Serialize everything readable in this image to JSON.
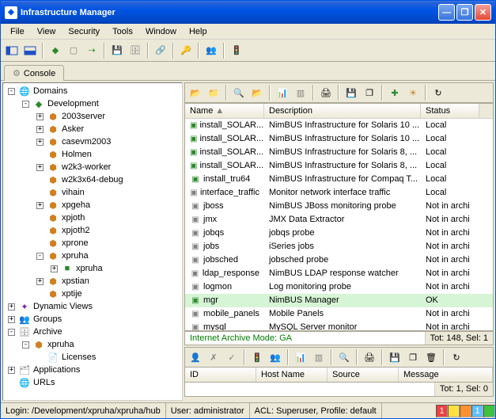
{
  "window": {
    "title": "Infrastructure Manager"
  },
  "menu": [
    "File",
    "View",
    "Security",
    "Tools",
    "Window",
    "Help"
  ],
  "tab": {
    "label": "Console"
  },
  "tree": [
    {
      "ind": 0,
      "exp": "-",
      "icon": "🌐",
      "cls": "ic-blue",
      "label": "Domains"
    },
    {
      "ind": 1,
      "exp": "-",
      "icon": "◆",
      "cls": "ic-green",
      "label": "Development"
    },
    {
      "ind": 2,
      "exp": "+",
      "icon": "⬢",
      "cls": "ic-orange",
      "label": "2003server"
    },
    {
      "ind": 2,
      "exp": "+",
      "icon": "⬢",
      "cls": "ic-orange",
      "label": "Asker"
    },
    {
      "ind": 2,
      "exp": "+",
      "icon": "⬢",
      "cls": "ic-orange",
      "label": "casevm2003"
    },
    {
      "ind": 2,
      "exp": "",
      "icon": "⬢",
      "cls": "ic-orange",
      "label": "Holmen"
    },
    {
      "ind": 2,
      "exp": "+",
      "icon": "⬢",
      "cls": "ic-orange",
      "label": "w2k3-worker"
    },
    {
      "ind": 2,
      "exp": "",
      "icon": "⬢",
      "cls": "ic-orange",
      "label": "w2k3x64-debug"
    },
    {
      "ind": 2,
      "exp": "",
      "icon": "⬢",
      "cls": "ic-orange",
      "label": "vihain"
    },
    {
      "ind": 2,
      "exp": "+",
      "icon": "⬢",
      "cls": "ic-orange",
      "label": "xpgeha"
    },
    {
      "ind": 2,
      "exp": "",
      "icon": "⬢",
      "cls": "ic-orange",
      "label": "xpjoth"
    },
    {
      "ind": 2,
      "exp": "",
      "icon": "⬢",
      "cls": "ic-orange",
      "label": "xpjoth2"
    },
    {
      "ind": 2,
      "exp": "",
      "icon": "⬢",
      "cls": "ic-orange",
      "label": "xprone"
    },
    {
      "ind": 2,
      "exp": "-",
      "icon": "⬢",
      "cls": "ic-orange",
      "label": "xpruha"
    },
    {
      "ind": 3,
      "exp": "+",
      "icon": "■",
      "cls": "ic-green",
      "label": "xpruha"
    },
    {
      "ind": 2,
      "exp": "+",
      "icon": "⬢",
      "cls": "ic-orange",
      "label": "xpstian"
    },
    {
      "ind": 2,
      "exp": "",
      "icon": "⬢",
      "cls": "ic-orange",
      "label": "xptije"
    },
    {
      "ind": 0,
      "exp": "+",
      "icon": "✦",
      "cls": "ic-purple",
      "label": "Dynamic Views"
    },
    {
      "ind": 0,
      "exp": "+",
      "icon": "👥",
      "cls": "ic-blue",
      "label": "Groups"
    },
    {
      "ind": 0,
      "exp": "-",
      "icon": "🗄",
      "cls": "ic-gray",
      "label": "Archive"
    },
    {
      "ind": 1,
      "exp": "-",
      "icon": "⬢",
      "cls": "ic-orange",
      "label": "xpruha"
    },
    {
      "ind": 2,
      "exp": "",
      "icon": "📄",
      "cls": "ic-gray",
      "label": "Licenses"
    },
    {
      "ind": 0,
      "exp": "+",
      "icon": "🗂",
      "cls": "ic-gray",
      "label": "Applications"
    },
    {
      "ind": 0,
      "exp": "",
      "icon": "🌐",
      "cls": "ic-blue",
      "label": "URLs"
    }
  ],
  "columns": {
    "name": "Name",
    "desc": "Description",
    "status": "Status"
  },
  "col_widths": {
    "name": 100,
    "desc": 198,
    "status": 74
  },
  "rows": [
    {
      "ic": "g",
      "name": "install_SOLAR...",
      "desc": "NimBUS Infrastructure for Solaris 10 ...",
      "status": "Local"
    },
    {
      "ic": "g",
      "name": "install_SOLAR...",
      "desc": "NimBUS Infrastructure for Solaris 10 ...",
      "status": "Local"
    },
    {
      "ic": "g",
      "name": "install_SOLAR...",
      "desc": "NimBUS Infrastructure for Solaris 8, ...",
      "status": "Local"
    },
    {
      "ic": "g",
      "name": "install_SOLAR...",
      "desc": "NimBUS Infrastructure for Solaris 8, ...",
      "status": "Local"
    },
    {
      "ic": "g",
      "name": "install_tru64",
      "desc": "NimBUS Infrastructure for Compaq T...",
      "status": "Local"
    },
    {
      "ic": "d",
      "name": "interface_traffic",
      "desc": "Monitor network interface traffic",
      "status": "Local"
    },
    {
      "ic": "d",
      "name": "jboss",
      "desc": "NimBUS JBoss monitoring probe",
      "status": "Not in archi"
    },
    {
      "ic": "d",
      "name": "jmx",
      "desc": "JMX Data Extractor",
      "status": "Not in archi"
    },
    {
      "ic": "d",
      "name": "jobqs",
      "desc": "jobqs probe",
      "status": "Not in archi"
    },
    {
      "ic": "d",
      "name": "jobs",
      "desc": "iSeries jobs",
      "status": "Not in archi"
    },
    {
      "ic": "d",
      "name": "jobsched",
      "desc": "jobsched probe",
      "status": "Not in archi"
    },
    {
      "ic": "d",
      "name": "ldap_response",
      "desc": "NimBUS LDAP response watcher",
      "status": "Not in archi"
    },
    {
      "ic": "d",
      "name": "logmon",
      "desc": "Log monitoring probe",
      "status": "Not in archi"
    },
    {
      "ic": "g",
      "name": "mgr",
      "desc": "NimBUS Manager",
      "status": "OK",
      "sel": true
    },
    {
      "ic": "d",
      "name": "mobile_panels",
      "desc": "Mobile Panels",
      "status": "Not in archi"
    },
    {
      "ic": "d",
      "name": "mysql",
      "desc": "MySQL Server monitor",
      "status": "Not in archi"
    }
  ],
  "status_strip": {
    "left": "Internet Archive Mode: GA",
    "right": "Tot: 148, Sel: 1"
  },
  "bottom_cols": [
    "ID",
    "Host Name",
    "Source",
    "Message"
  ],
  "bottom_status": {
    "right": "Tot: 1, Sel: 0"
  },
  "statusbar": {
    "login": "Login: /Development/xpruha/xpruha/hub",
    "user": "User: administrator",
    "acl": "ACL: Superuser, Profile: default",
    "ind1": "1",
    "ind2": "1"
  }
}
